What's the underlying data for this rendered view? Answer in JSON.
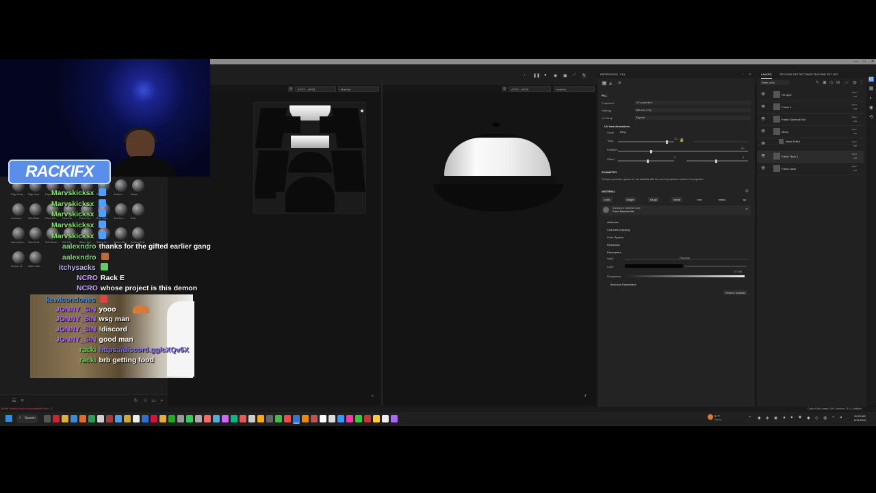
{
  "app": {
    "window_controls": [
      "—",
      "□",
      "✕"
    ],
    "viewport_2d": {
      "colorspace": "ACES - sRGB",
      "mode": "Material"
    },
    "viewport_3d": {
      "colorspace": "ACES - sRGB",
      "mode": "Material"
    }
  },
  "properties": {
    "tab_label": "PROPERTIES - FILL",
    "section_fill": "FILL",
    "rows": [
      {
        "label": "Projection",
        "value": "UV projection"
      },
      {
        "label": "Filtering",
        "value": "Bilinear | HQ"
      },
      {
        "label": "UV Wrap",
        "value": "Repeat"
      }
    ],
    "uv_transform_label": "UV transformations",
    "scale_label": "Scale",
    "scale_value": "Tiling",
    "tiling_label": "Tiling",
    "tiling_value": "10",
    "rotation_label": "Rotation",
    "rotation_value": "90",
    "offset_label": "Offset",
    "offset_values": [
      "0",
      "0"
    ],
    "symmetry_title": "SYMMETRY",
    "symmetry_text": "Fill layer symmetry options are not available with the current projection method: UV projection",
    "material_title": "MATERIAL",
    "channels": [
      "color",
      "height",
      "rough",
      "metal",
      "nrm",
      "emiss",
      "op"
    ],
    "material_mode": "Substance material mode",
    "material_name": "Fabric Baseball Hat",
    "subsections": [
      "Attributes",
      "Channels mapping",
      "Color Spaces",
      "Resolution",
      "Parameters"
    ],
    "seed_label": "Seed",
    "seed_value": "Random",
    "color_label": "Color",
    "roughness_label": "Roughness",
    "roughness_value": "0.7785",
    "technical_params": "Technical Parameters",
    "restore_defaults": "Restore defaults"
  },
  "layers": {
    "tabs": [
      "LAYERS",
      "TEXTURE SET SETTINGS",
      "TEXTURE SET LIST"
    ],
    "base_color": "Base color",
    "items": [
      {
        "name": "Fill layer",
        "blend": "Norm",
        "opacity": "100"
      },
      {
        "name": "Folder 1",
        "blend": "Norm",
        "opacity": "100"
      },
      {
        "name": "Fabric Baseball Hat",
        "blend": "Norm",
        "opacity": "100"
      },
      {
        "name": "Mesa",
        "blend": "Norm",
        "opacity": "100"
      },
      {
        "name": "Mask Editor",
        "blend": "Norm",
        "opacity": "100"
      },
      {
        "name": "Fabric Rack 1",
        "blend": "Norm",
        "opacity": "100"
      },
      {
        "name": "Fabric Base",
        "blend": "Norm",
        "opacity": "100"
      }
    ]
  },
  "status": {
    "left_error": "[Shelf] Failed to load resources/shelf/Folder 1.2",
    "right": "Cache Disk Usage: 34% | Version: 11.1.2 (Adobe)"
  },
  "taskbar": {
    "search_label": "Search",
    "weather": "57°F",
    "weather_sub": "Sunny",
    "time": "11:39 AM",
    "date": "6/11/2026"
  },
  "stream": {
    "logo_text": "RACKIFX",
    "chat": [
      {
        "user": "Marvskicksx",
        "msg": "",
        "color": "#86e36a"
      },
      {
        "user": "Marvskicksx",
        "msg": "",
        "color": "#86e36a"
      },
      {
        "user": "Marvskicksx",
        "msg": "",
        "color": "#86e36a"
      },
      {
        "user": "Marvskicksx",
        "msg": "",
        "color": "#86e36a"
      },
      {
        "user": "Marvskicksx",
        "msg": "",
        "color": "#86e36a"
      },
      {
        "user": "aalexndro",
        "msg": "thanks for the gifted earlier gang",
        "color": "#7ad67a"
      },
      {
        "user": "aalexndro",
        "msg": "",
        "color": "#7ad67a"
      },
      {
        "user": "itchysacks",
        "msg": "",
        "color": "#b8b8ff"
      },
      {
        "user": "NCRO",
        "msg": "Rack E",
        "color": "#c9a6ff"
      },
      {
        "user": "NCRO",
        "msg": "whose project is this demon",
        "color": "#c9a6ff"
      },
      {
        "user": "kewlcondones",
        "msg": "",
        "color": "#3b8cff"
      },
      {
        "user": "JONNY_SIN",
        "msg": "yooo",
        "color": "#b266ff"
      },
      {
        "user": "JONNY_SIN",
        "msg": "wsg man",
        "color": "#b266ff"
      },
      {
        "user": "JONNY_SIN",
        "msg": "!discord",
        "color": "#b266ff"
      },
      {
        "user": "JONNY_SIN",
        "msg": "good man",
        "color": "#b266ff"
      },
      {
        "user": "racki",
        "msg": "https://discord.gg/cXQv5X",
        "color": "#4cdd4c",
        "msg_color": "#7d6bff"
      },
      {
        "user": "racki",
        "msg": "brb getting food",
        "color": "#4cdd4c"
      }
    ]
  },
  "shelf": {
    "labels": [
      "Edge Dusty",
      "Edge Scra...",
      "Edges Wo...",
      "Edges Wo...",
      "Ground Dirt",
      "Rust Stips",
      "Moisture",
      "Maaat",
      "Occlusion",
      "Paint Dam...",
      "Prism Dirt",
      "Paint Dirt",
      "Paint Gum",
      "Rust Stips",
      "Rust Gro...",
      "Rust",
      "Sand Ceme...",
      "Sand Shat",
      "Soft Dama...",
      "Soft Dirt",
      "Stains Scu...",
      "Stains Scr...",
      "Suture Stro",
      "Surface Rust",
      "Surface M...",
      "Water Stain"
    ]
  }
}
